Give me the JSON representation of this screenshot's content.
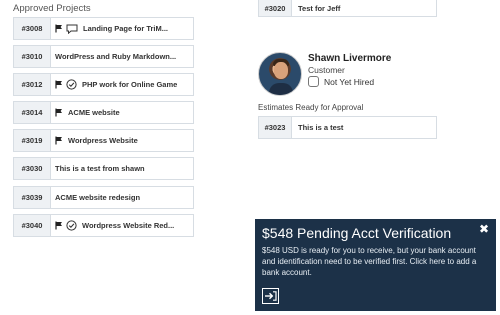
{
  "approved_projects": {
    "title": "Approved Projects",
    "items": [
      {
        "id": "#3008",
        "name": "Landing Page for TriM...",
        "icons": [
          "flag-icon",
          "chat-icon"
        ]
      },
      {
        "id": "#3010",
        "name": "WordPress and Ruby Markdown...",
        "icons": []
      },
      {
        "id": "#3012",
        "name": "PHP work for Online Game",
        "icons": [
          "flag-icon",
          "check-circle-icon"
        ]
      },
      {
        "id": "#3014",
        "name": "ACME website",
        "icons": [
          "flag-icon"
        ]
      },
      {
        "id": "#3019",
        "name": "Wordpress Website",
        "icons": [
          "flag-icon"
        ]
      },
      {
        "id": "#3030",
        "name": "This is a test from shawn",
        "icons": []
      },
      {
        "id": "#3039",
        "name": "ACME website redesign",
        "icons": []
      },
      {
        "id": "#3040",
        "name": "Wordpress Website Red...",
        "icons": [
          "flag-icon",
          "check-circle-icon"
        ]
      }
    ]
  },
  "top_card": {
    "id": "#3020",
    "name": "Test for Jeff"
  },
  "client": {
    "name": "Shawn Livermore",
    "role": "Customer",
    "hire_status": "Not Yet Hired"
  },
  "estimates": {
    "title": "Estimates Ready for Approval",
    "items": [
      {
        "id": "#3023",
        "name": "This is a test"
      }
    ]
  },
  "verification": {
    "title": "$548 Pending Acct Verification",
    "message": "$548 USD is ready for you to receive, but your bank account and identification need to be verified first. Click here to add a bank account.",
    "close_glyph": "✖",
    "colors": {
      "background": "#1c3148",
      "text": "#ffffff"
    }
  }
}
